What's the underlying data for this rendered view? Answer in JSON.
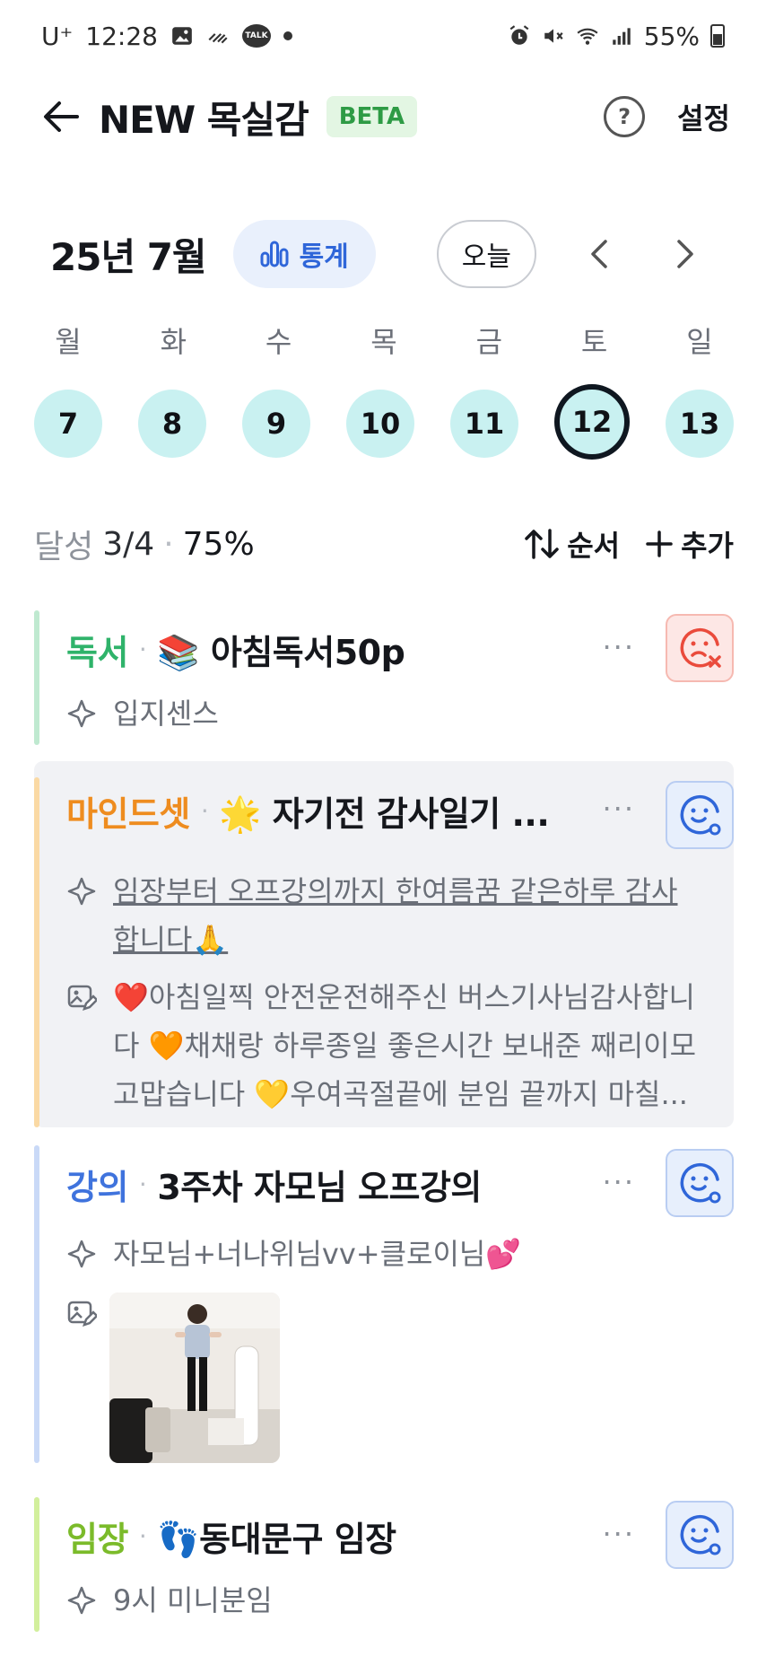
{
  "status_bar": {
    "carrier": "U⁺",
    "time": "12:28",
    "battery": "55%",
    "icons": [
      "image-icon",
      "pattern-icon",
      "talk-icon",
      "dot-icon",
      "alarm-icon",
      "mute-icon",
      "wifi-icon",
      "signal-icon",
      "battery-icon"
    ],
    "talk_label": "TALK"
  },
  "header": {
    "title": "NEW 목실감",
    "badge": "BETA",
    "help": "?",
    "settings": "설정"
  },
  "calendar": {
    "month": "25년 7월",
    "stats_label": "통계",
    "today_label": "오늘",
    "days": [
      {
        "name": "월",
        "date": "7"
      },
      {
        "name": "화",
        "date": "8"
      },
      {
        "name": "수",
        "date": "9"
      },
      {
        "name": "목",
        "date": "10"
      },
      {
        "name": "금",
        "date": "11"
      },
      {
        "name": "토",
        "date": "12"
      },
      {
        "name": "일",
        "date": "13"
      }
    ],
    "selected_date": "12"
  },
  "summary": {
    "label": "달성",
    "count": "3/4",
    "percent": "75%",
    "order_label": "순서",
    "add_label": "추가"
  },
  "items": [
    {
      "category": "독서",
      "title": "📚 아침독서50p",
      "note": "입지센스",
      "status": "fail",
      "color": "#7fd8a8",
      "category_color": "#2fb36a"
    },
    {
      "category": "마인드셋",
      "title": "🌟 자기전 감사일기 ...",
      "note_line1": "임장부터 오프강의까지 한여름꿈 같은하루 감사",
      "note_line2": "합니다🙏",
      "journal_line1": "❤️아침일찍 안전운전해주신 버스기사님감사합니",
      "journal_line2": "다 🧡채채랑 하루종일 좋은시간 보내준 째리이모",
      "journal_line3": "고맙습니다 💛우여곡절끝에 분임 끝까지 마칠...",
      "status": "done",
      "color": "#fad9a4",
      "category_color": "#ee8c1f"
    },
    {
      "category": "강의",
      "title": "3주차 자모님 오프강의",
      "note": "자모님+너나위님vv+클로이님💕",
      "status": "done",
      "color": "#c9d9f7",
      "category_color": "#3f73dd"
    },
    {
      "category": "임장",
      "title": "👣동대문구 임장",
      "note": "9시 미니분임",
      "status": "done",
      "color": "#d2ef9c",
      "category_color": "#7bbb2a"
    }
  ],
  "more_label": "···"
}
